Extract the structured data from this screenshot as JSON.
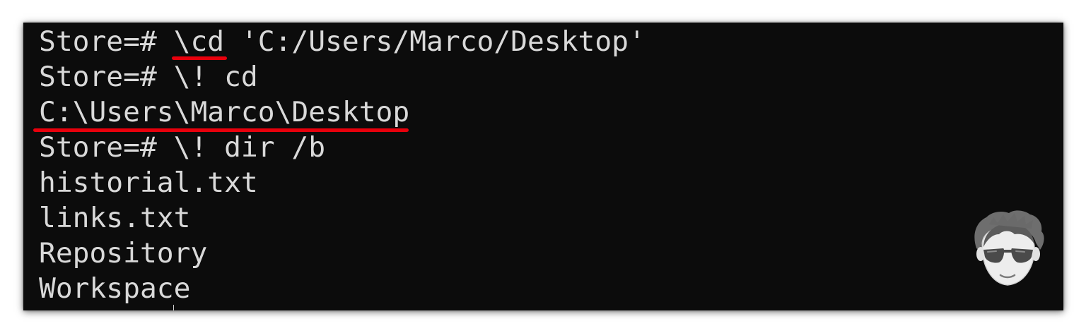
{
  "terminal": {
    "lines": [
      "Store=# \\cd 'C:/Users/Marco/Desktop'",
      "Store=# \\! cd",
      "C:\\Users\\Marco\\Desktop",
      "Store=# \\! dir /b",
      "historial.txt",
      "links.txt",
      "Repository",
      "Workspace"
    ]
  },
  "annotations": {
    "highlight_color": "#e8000c"
  },
  "watermark": {
    "icon": "avatar-with-sunglasses-icon"
  }
}
